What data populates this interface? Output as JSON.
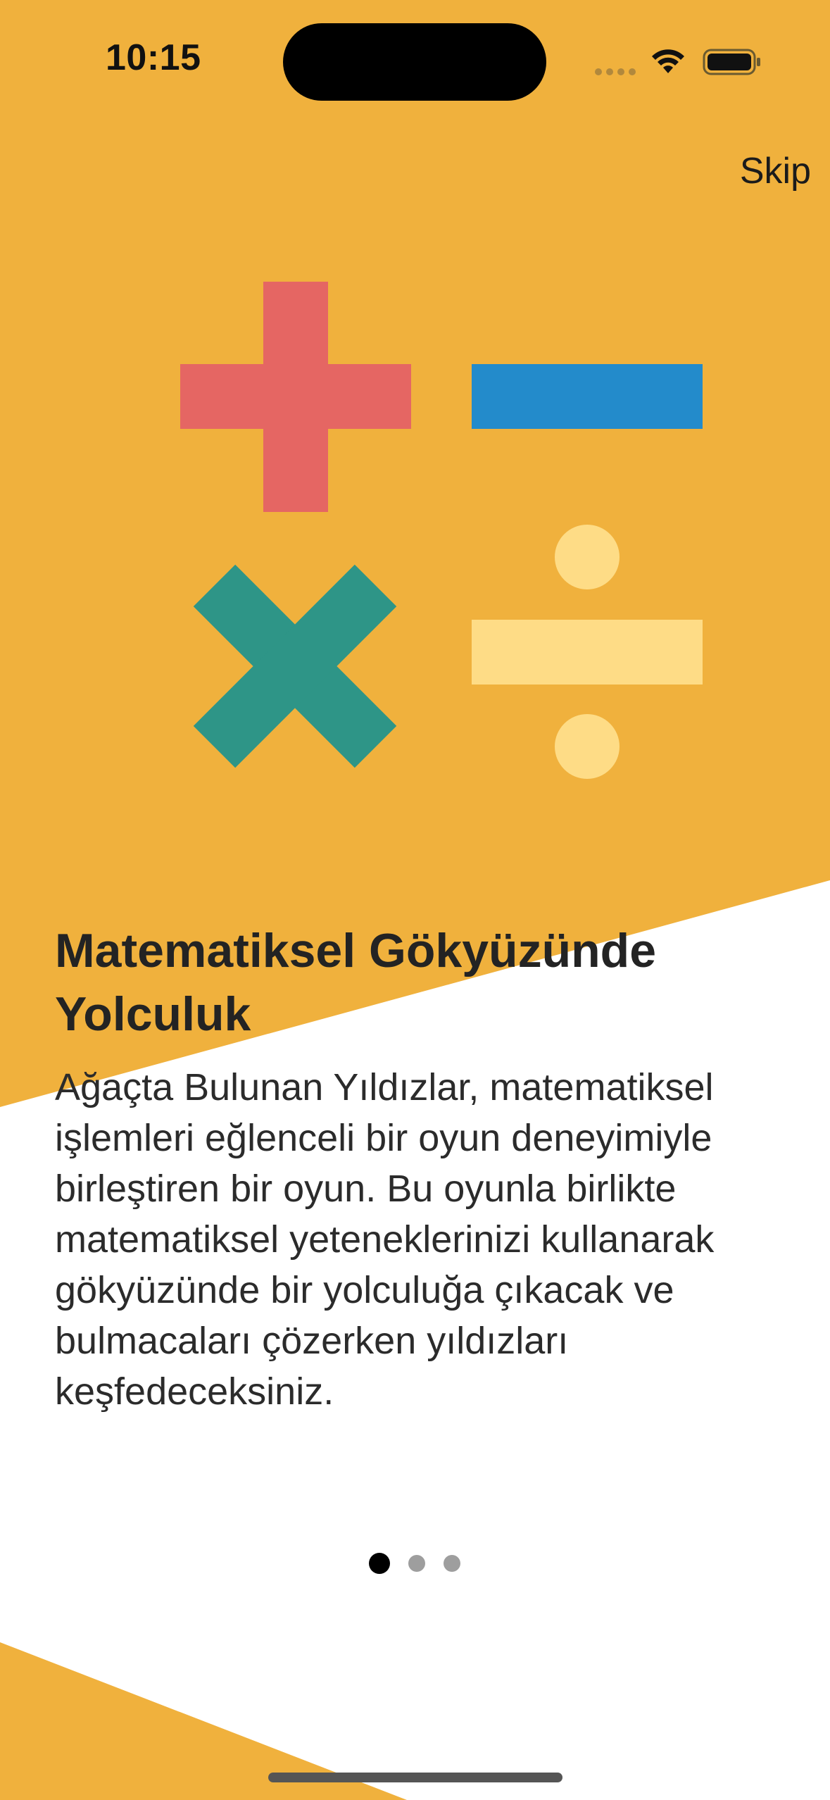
{
  "status_bar": {
    "time": "10:15"
  },
  "colors": {
    "background_accent": "#F0B13D",
    "plus": "#E56663",
    "minus": "#238BCB",
    "times": "#2E9587",
    "divide": "#FEDC86",
    "dot_active": "#000000",
    "dot_inactive": "#9E9E9E"
  },
  "header": {
    "skip_label": "Skip"
  },
  "illustration": {
    "symbols": [
      "plus-icon",
      "minus-icon",
      "times-icon",
      "divide-icon"
    ]
  },
  "content": {
    "title": "Matematiksel Gökyüzünde Yolculuk",
    "description": "Ağaçta Bulunan Yıldızlar, matematiksel işlemleri eğlenceli bir oyun deneyimiyle birleştiren bir oyun. Bu oyunla birlikte matematiksel yeteneklerinizi kullanarak gökyüzünde bir yolculuğa çıkacak ve bulmacaları çözerken yıldızları keşfedeceksiniz."
  },
  "pagination": {
    "total": 3,
    "current": 1
  }
}
